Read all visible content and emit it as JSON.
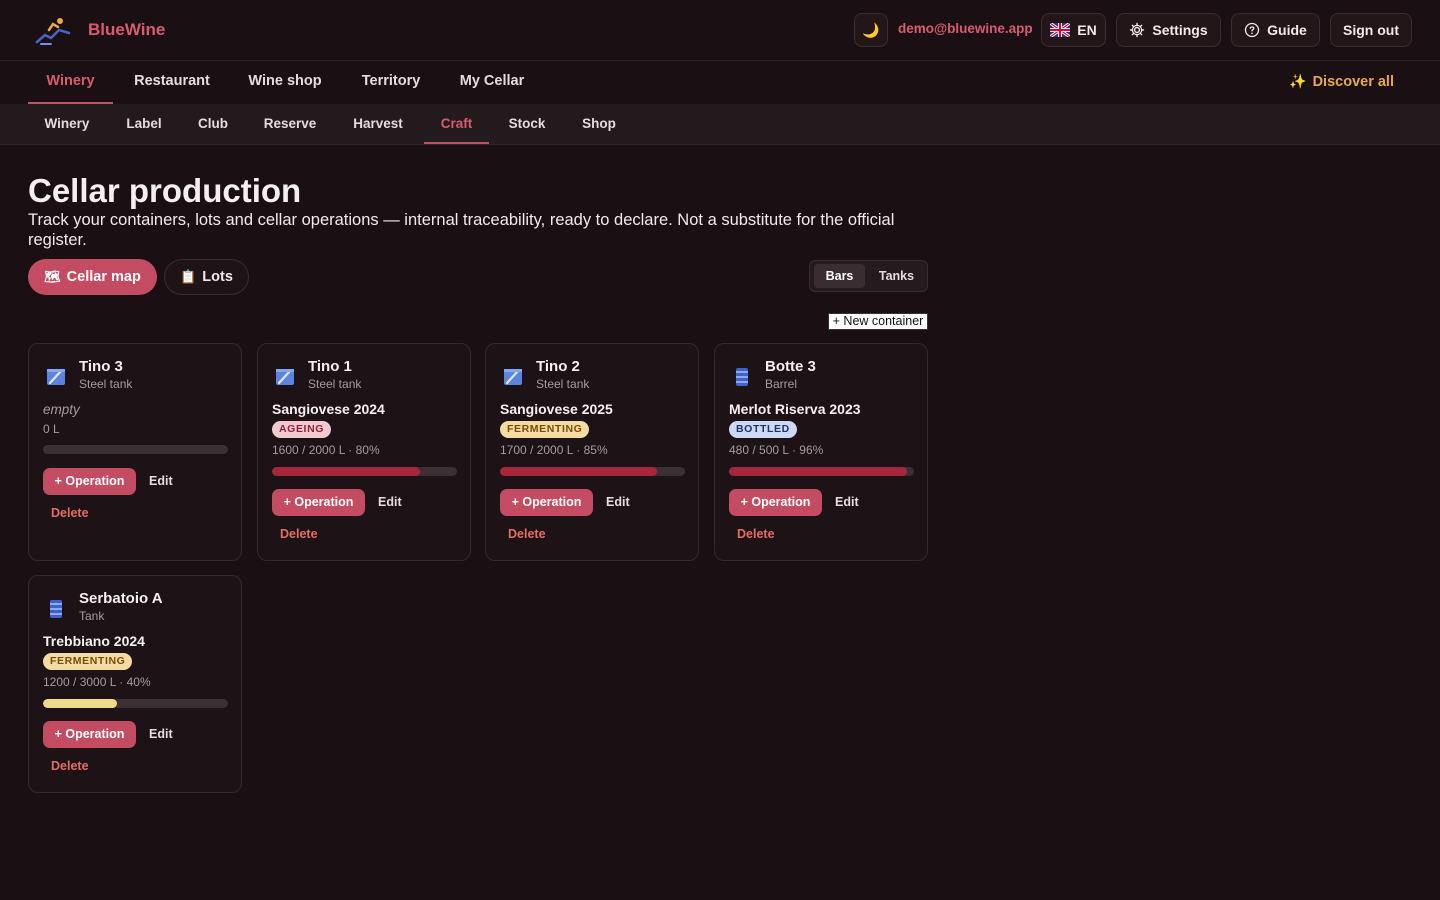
{
  "header": {
    "brand": "BlueWine",
    "theme_icon": "moon-icon",
    "email": "demo@bluewine.app",
    "language": "EN",
    "settings_label": "Settings",
    "guide_label": "Guide",
    "signout_label": "Sign out"
  },
  "nav_main": {
    "items": [
      "Winery",
      "Restaurant",
      "Wine shop",
      "Territory",
      "My Cellar"
    ],
    "active": "Winery",
    "discover_label": "Discover all"
  },
  "nav_sub": {
    "items": [
      "Winery",
      "Label",
      "Club",
      "Reserve",
      "Harvest",
      "Craft",
      "Stock",
      "Shop"
    ],
    "active": "Craft"
  },
  "page": {
    "title": "Cellar production",
    "subtitle": "Track your containers, lots and cellar operations — internal traceability, ready to declare. Not a substitute for the official register.",
    "cellar_map_label": "Cellar map",
    "lots_label": "Lots",
    "view_toggle": [
      "Bars",
      "Tanks"
    ],
    "view_active": "Bars",
    "new_container_label": "+ New container"
  },
  "actions": {
    "operation": "+ Operation",
    "edit": "Edit",
    "delete": "Delete"
  },
  "containers": [
    {
      "name": "Tino 3",
      "type": "Steel tank",
      "icon": "steel-tank-icon",
      "wine": "",
      "empty_label": "empty",
      "status": "",
      "quantity": "0 L",
      "fill_pct": 0
    },
    {
      "name": "Tino 1",
      "type": "Steel tank",
      "icon": "steel-tank-icon",
      "wine": "Sangiovese 2024",
      "status": "AGEING",
      "quantity": "1600 / 2000 L · 80%",
      "fill_pct": 80
    },
    {
      "name": "Tino 2",
      "type": "Steel tank",
      "icon": "steel-tank-icon",
      "wine": "Sangiovese 2025",
      "status": "FERMENTING",
      "quantity": "1700 / 2000 L · 85%",
      "fill_pct": 85
    },
    {
      "name": "Botte 3",
      "type": "Barrel",
      "icon": "barrel-icon",
      "wine": "Merlot Riserva 2023",
      "status": "BOTTLED",
      "quantity": "480 / 500 L · 96%",
      "fill_pct": 96
    },
    {
      "name": "Serbatoio A",
      "type": "Tank",
      "icon": "barrel-icon",
      "wine": "Trebbiano 2024",
      "status": "FERMENTING",
      "quantity": "1200 / 3000 L · 40%",
      "fill_pct": 40
    }
  ]
}
